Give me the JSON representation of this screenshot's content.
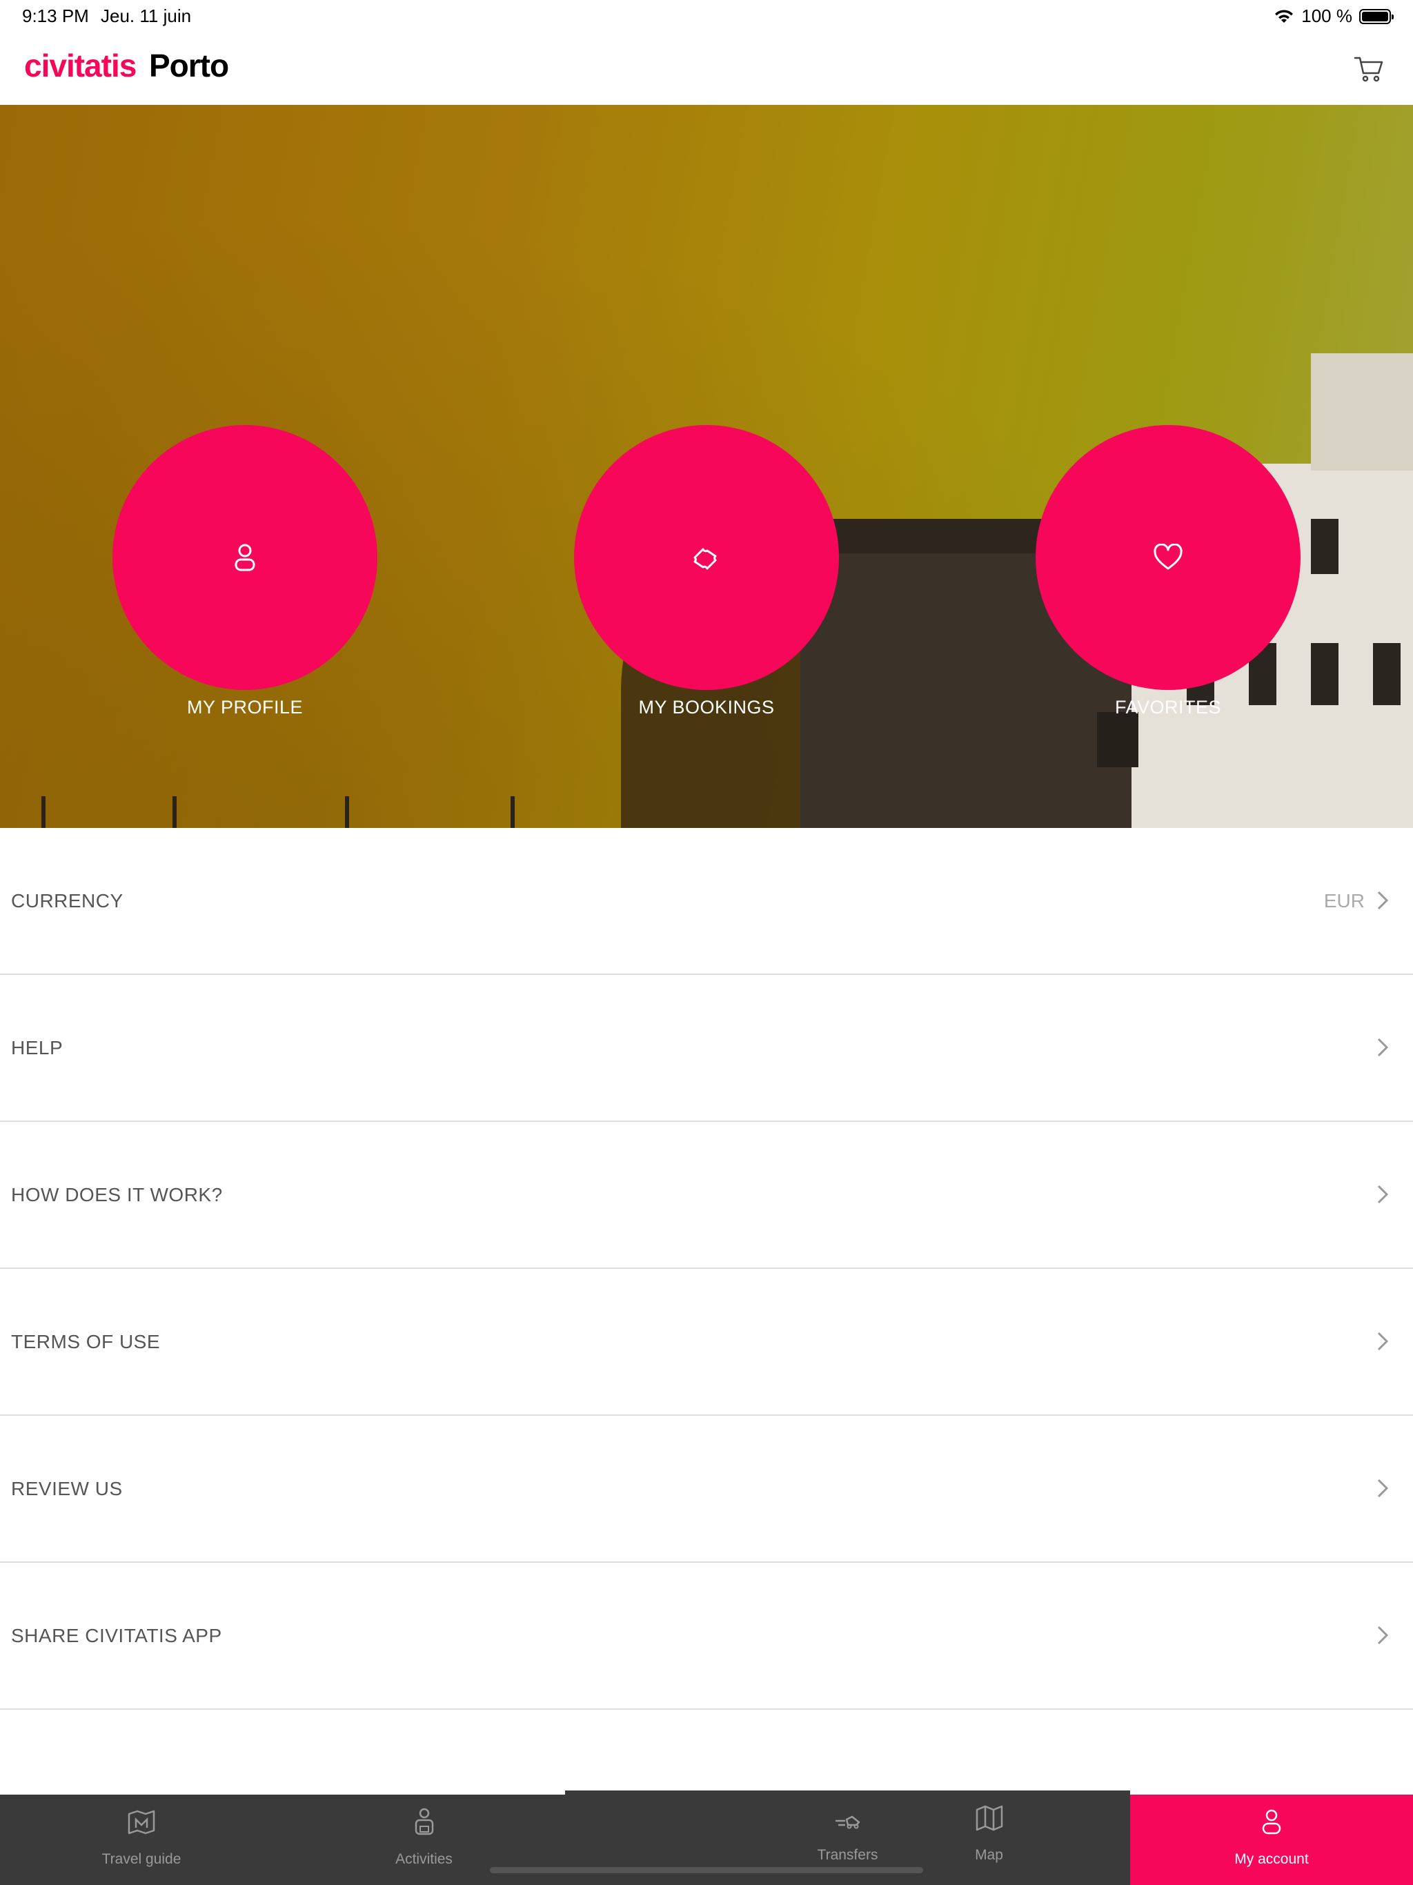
{
  "status_bar": {
    "time": "9:13 PM",
    "date": "Jeu. 11 juin",
    "battery": "100 %",
    "battery_level": 1.0
  },
  "header": {
    "brand": "civitatis",
    "city": "Porto",
    "cart_icon": "cart-icon"
  },
  "hero": {
    "buttons": [
      {
        "label": "MY PROFILE",
        "icon": "user-icon"
      },
      {
        "label": "MY BOOKINGS",
        "icon": "ticket-icon"
      },
      {
        "label": "FAVORITES",
        "icon": "heart-icon"
      }
    ]
  },
  "menu": [
    {
      "label": "CURRENCY",
      "value": "EUR"
    },
    {
      "label": "HELP",
      "value": ""
    },
    {
      "label": "HOW DOES IT WORK?",
      "value": ""
    },
    {
      "label": "TERMS OF USE",
      "value": ""
    },
    {
      "label": "REVIEW US",
      "value": ""
    },
    {
      "label": "SHARE CIVITATIS APP",
      "value": ""
    }
  ],
  "tabbar": {
    "tabs": [
      {
        "label": "Travel guide",
        "icon": "guide-map-icon"
      },
      {
        "label": "Activities",
        "icon": "activities-icon"
      },
      {
        "label": "Transfers",
        "icon": "transfers-icon"
      },
      {
        "label": "Map",
        "icon": "map-icon"
      },
      {
        "label": "My account",
        "icon": "account-icon",
        "active": true
      }
    ]
  },
  "colors": {
    "accent": "#f70759",
    "tabbar_bg": "#3a3a3a",
    "hero_bg": "#a67a0a"
  }
}
